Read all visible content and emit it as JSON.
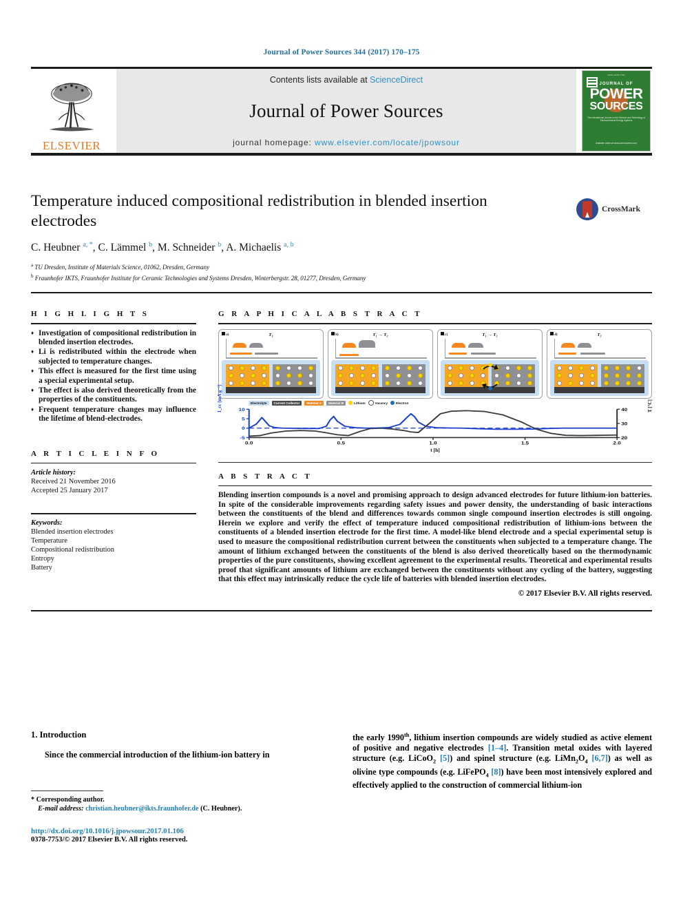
{
  "running_head": "Journal of Power Sources 344 (2017) 170–175",
  "masthead": {
    "contents_prefix": "Contents lists available at ",
    "sciencedirect": "ScienceDirect",
    "journal_title": "Journal of Power Sources",
    "homepage_prefix": "journal homepage: ",
    "homepage_url": "www.elsevier.com/locate/jpowsour",
    "publisher": "ELSEVIER",
    "cover": {
      "top_note": "ISSN 0378-7753",
      "journal_of": "JOURNAL OF",
      "power": "POWER",
      "sources": "SOURCES",
      "subtitle": "The International Journal on the Science and Technology of Electrochemical Energy Systems",
      "footer": "Available online at www.sciencedirect.com"
    },
    "link_color": "#2d8fc4"
  },
  "article": {
    "title": "Temperature induced compositional redistribution in blended insertion electrodes",
    "crossmark_label": "CrossMark",
    "authors": [
      {
        "name": "C. Heubner",
        "marks": "a, *"
      },
      {
        "name": "C. Lämmel",
        "marks": "b"
      },
      {
        "name": "M. Schneider",
        "marks": "b"
      },
      {
        "name": "A. Michaelis",
        "marks": "a, b"
      }
    ],
    "affiliations": [
      {
        "mark": "a",
        "text": "TU Dresden, Institute of Materials Science, 01062, Dresden, Germany"
      },
      {
        "mark": "b",
        "text": "Fraunhofer IKTS, Fraunhofer Institute for Ceramic Technologies and Systems Dresden, Winterbergstr. 28, 01277, Dresden, Germany"
      }
    ]
  },
  "sections": {
    "highlights_head": "H I G H L I G H T S",
    "graphical_abstract_head": "G R A P H I C A L   A B S T R A C T",
    "article_info_head": "A R T I C L E   I N F O",
    "abstract_head": "A B S T R A C T"
  },
  "highlights": [
    "Investigation of compositional redistribution in blended insertion electrodes.",
    "Li is redistributed within the electrode when subjected to temperature changes.",
    "This effect is measured for the first time using a special experimental setup.",
    "The effect is also derived theoretically from the properties of the constituents.",
    "Frequent temperature changes may influence the lifetime of blend-electrodes."
  ],
  "article_info": {
    "history_label": "Article history:",
    "received": "Received 21 November 2016",
    "accepted": "Accepted 25 January 2017",
    "keywords_label": "Keywords:",
    "keywords": [
      "Blended insertion electrodes",
      "Temperature",
      "Compositional redistribution",
      "Entropy",
      "Battery"
    ]
  },
  "abstract": {
    "text": "Blending insertion compounds is a novel and promising approach to design advanced electrodes for future lithium-ion batteries. In spite of the considerable improvements regarding safety issues and power density, the understanding of basic interactions between the constituents of the blend and differences towards common single compound insertion electrodes is still ongoing. Herein we explore and verify the effect of temperature induced compositional redistribution of lithium-ions between the constituents of a blended insertion electrode for the first time. A model-like blend electrode and a special experimental setup is used to measure the compositional redistribution current between the constituents when subjected to a temperature change. The amount of lithium exchanged between the constituents of the blend is also derived theoretically based on the thermodynamic properties of the pure constituents, showing excellent agreement to the experimental results. Theoretical and experimental results proof that significant amounts of lithium are exchanged between the constituents without any cycling of the battery, suggesting that this effect may intrinsically reduce the cycle life of batteries with blended insertion electrodes.",
    "copyright": "© 2017 Elsevier B.V. All rights reserved."
  },
  "graphical_abstract": {
    "panels": [
      {
        "label": "a)",
        "condition": "T₁"
      },
      {
        "label": "b)",
        "condition": "T₁ → T₂"
      },
      {
        "label": "c)",
        "condition": "T₁ → T₂"
      },
      {
        "label": "d)",
        "condition": "T₂"
      }
    ],
    "legend": [
      {
        "key": "electrolyte",
        "label": "Electrolyte",
        "color": "#c6ddf2"
      },
      {
        "key": "current-collector",
        "label": "Current Collector",
        "color": "#4a4a4a"
      },
      {
        "key": "material-a",
        "label": "Material A",
        "color": "#f5871f"
      },
      {
        "key": "material-b",
        "label": "Material B",
        "color": "#8f9094"
      },
      {
        "key": "lithium",
        "label": "Lithium",
        "color": "#ffd400"
      },
      {
        "key": "vacancy",
        "label": "Vacancy",
        "color": "#ffffff"
      },
      {
        "key": "electron",
        "label": "Electron",
        "color": "#1f6fb8"
      }
    ]
  },
  "chart_data": {
    "type": "line",
    "title": "",
    "xlabel": "t [h]",
    "ylabel": "I_cc [mA g⁻¹]",
    "y2label": "T [°C]",
    "xlim": [
      0.0,
      2.0
    ],
    "ylim": [
      -5,
      10
    ],
    "y2lim": [
      20,
      40
    ],
    "xticks": [
      "0.0",
      "0.5",
      "1.0",
      "1.5",
      "2.0"
    ],
    "yticks": [
      "-5",
      "0",
      "5",
      "10"
    ],
    "y2ticks": [
      "20",
      "30",
      "40"
    ],
    "grid": false,
    "legend_position": "top",
    "series": [
      {
        "name": "I_cc [mA g⁻¹]",
        "color": "#1a3fd0",
        "x": [
          0.0,
          0.04,
          0.07,
          0.09,
          0.11,
          0.14,
          0.18,
          0.25,
          0.32,
          0.38,
          0.42,
          0.44,
          0.46,
          0.48,
          0.52,
          0.58,
          0.64,
          0.7,
          0.76,
          0.82,
          0.86,
          0.88,
          0.9,
          0.92,
          0.96,
          1.02,
          1.08,
          1.16,
          1.24,
          1.34,
          1.44,
          1.54,
          1.62,
          1.7,
          1.8,
          1.9,
          2.0
        ],
        "y": [
          0.0,
          2.2,
          5.6,
          3.4,
          1.2,
          0.3,
          0.0,
          -0.1,
          -0.2,
          -0.2,
          1.0,
          4.2,
          6.2,
          3.6,
          1.0,
          0.2,
          0.0,
          0.1,
          0.3,
          2.0,
          5.8,
          7.6,
          6.0,
          3.2,
          1.0,
          0.2,
          0.1,
          0.0,
          -0.3,
          -0.6,
          -0.6,
          -0.5,
          -0.2,
          0.0,
          0.0,
          0.0,
          0.0
        ]
      },
      {
        "name": "T [°C]",
        "color": "#3c3c3c",
        "x": [
          0.0,
          0.06,
          0.12,
          0.2,
          0.28,
          0.36,
          0.42,
          0.48,
          0.54,
          0.6,
          0.66,
          0.72,
          0.78,
          0.84,
          0.88,
          0.92,
          0.98,
          1.04,
          1.1,
          1.18,
          1.28,
          1.38,
          1.48,
          1.56,
          1.64,
          1.72,
          1.8,
          1.9,
          2.0
        ],
        "y": [
          21.0,
          21.4,
          23.2,
          24.6,
          25.0,
          24.6,
          23.4,
          22.0,
          21.4,
          24.2,
          26.4,
          26.6,
          26.0,
          25.0,
          24.0,
          23.6,
          30.0,
          36.8,
          38.6,
          39.0,
          38.4,
          36.0,
          31.0,
          26.0,
          23.0,
          21.6,
          21.4,
          21.6,
          21.8
        ]
      },
      {
        "name": "zero-reference",
        "color": "#1a3fd0",
        "style": "dashed",
        "x": [
          0.0,
          2.0
        ],
        "y": [
          0.0,
          0.0
        ]
      }
    ]
  },
  "introduction": {
    "heading": "1. Introduction",
    "left_paragraph": "Since the commercial introduction of the lithium-ion battery in",
    "right_paragraph_pre": "the early 1990",
    "right_paragraph_sup": "th",
    "right_paragraph_rest": ", lithium insertion compounds are widely studied as active element of positive and negative electrodes ",
    "ref_1_4": "[1–4]",
    "after_ref1": ". Transition metal oxides with layered structure (e.g. LiCoO",
    "sub_2": "2",
    "ref_5": "[5]",
    "after_ref5": ") and spinel structure (e.g. LiMn",
    "sub_2b": "2",
    "o4": "O",
    "sub_4": "4",
    "ref_67": "[6,7]",
    "after_ref67": ") as well as olivine type compounds (e.g. LiFePO",
    "sub_4b": "4",
    "ref_8": "[8]",
    "after_ref8": ") have been most intensively explored and effectively applied to the construction of commercial lithium-ion"
  },
  "footer": {
    "corresponding_author": "* Corresponding author.",
    "email_label": "E-mail address:",
    "email": "christian.heubner@ikts.fraunhofer.de",
    "email_owner": "(C. Heubner).",
    "doi": "http://dx.doi.org/10.1016/j.jpowsour.2017.01.106",
    "issn_line": "0378-7753/© 2017 Elsevier B.V. All rights reserved."
  }
}
